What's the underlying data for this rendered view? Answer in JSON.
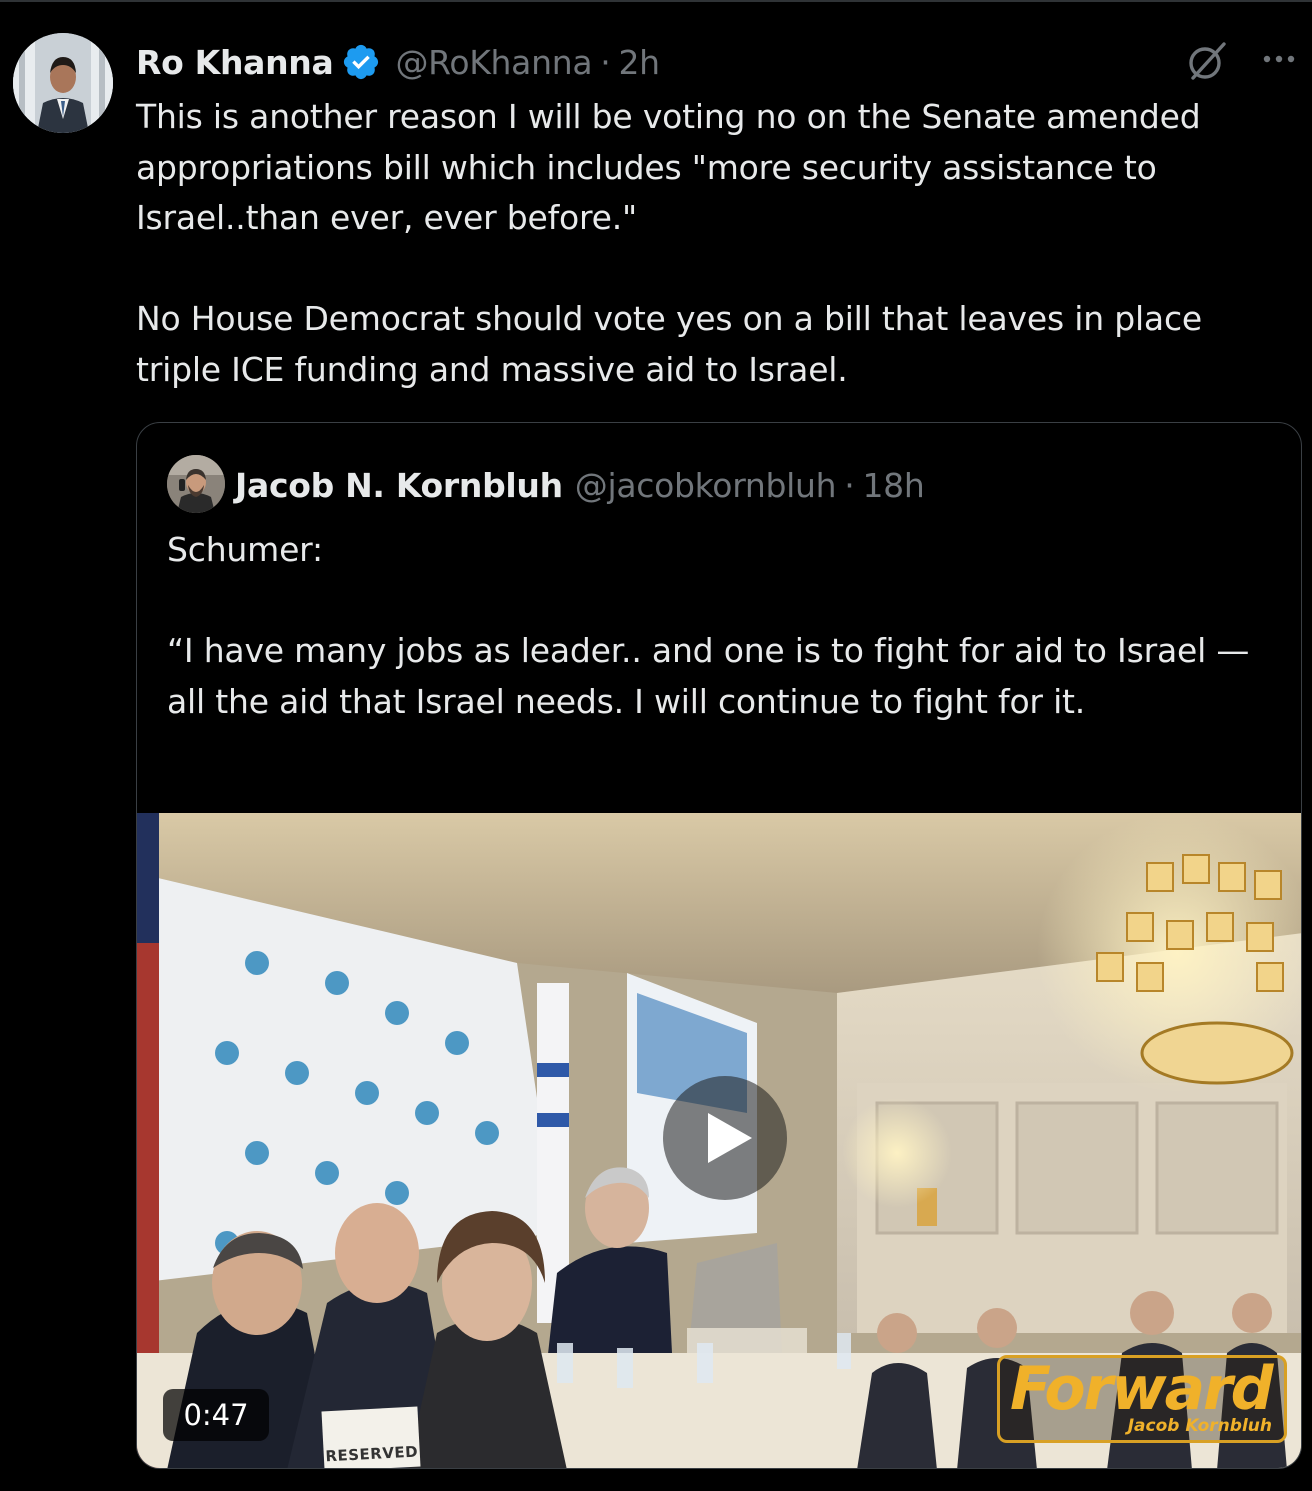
{
  "tweet": {
    "author": {
      "display_name": "Ro Khanna",
      "verified": true,
      "handle": "@RoKhanna",
      "separator": "·",
      "time": "2h"
    },
    "text": "This is another reason I will be voting no on the Senate amended appropriations bill which includes \"more security assistance to Israel..than ever, ever before.\"\n\nNo House Democrat should vote yes on a bill that leaves in place triple ICE funding and massive aid to Israel.",
    "icons": {
      "grok": "grok-icon",
      "more": "more-icon",
      "verified": "verified-badge-icon"
    },
    "colors": {
      "background": "#000000",
      "text": "#e7e9ea",
      "muted": "#71767b",
      "verified": "#1d9bf0",
      "border": "#2f3336"
    }
  },
  "quoted_tweet": {
    "author": {
      "display_name": "Jacob N. Kornbluh",
      "handle": "@jacobkornbluh",
      "separator": "·",
      "time": "18h"
    },
    "text": "Schumer:\n\n“I have many jobs as leader.. and one is to fight for aid to Israel — all the aid that Israel needs. I will continue to fight for it.",
    "truncation": "…",
    "video": {
      "duration": "0:47",
      "watermark_brand": "Forward",
      "watermark_author": "Jacob Kornbluh",
      "sign_text": "RESERVED",
      "icons": {
        "play": "play-icon"
      }
    }
  }
}
